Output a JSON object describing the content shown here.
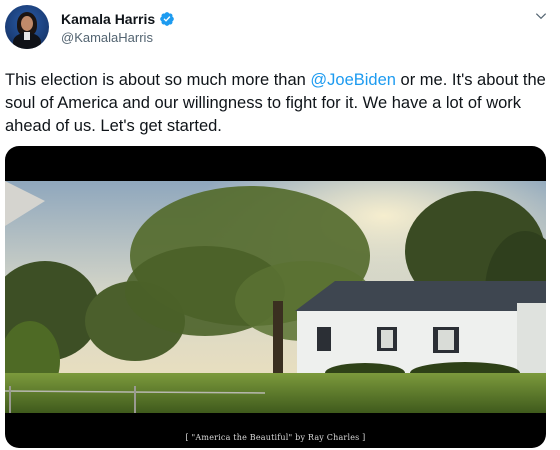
{
  "author": {
    "name": "Kamala Harris",
    "handle": "@KamalaHarris",
    "verified": true,
    "avatar_icon": "avatar-photo"
  },
  "tweet": {
    "parts": [
      {
        "text": "This election is about so much more than ",
        "type": "plain"
      },
      {
        "text": "@JoeBiden",
        "type": "mention"
      },
      {
        "text": " or me. It's about the soul of America and our willingness to fight for it. We have a lot of work ahead of us. Let's get started.",
        "type": "plain"
      }
    ]
  },
  "media": {
    "caption": "[ \"America the Beautiful\" by Ray Charles ]"
  },
  "colors": {
    "mention": "#1d9bf0",
    "verified": "#1d9bf0",
    "handle": "#536471",
    "media_background": "#000000"
  },
  "icons": [
    "verified-badge-icon",
    "chevron-down-icon"
  ]
}
